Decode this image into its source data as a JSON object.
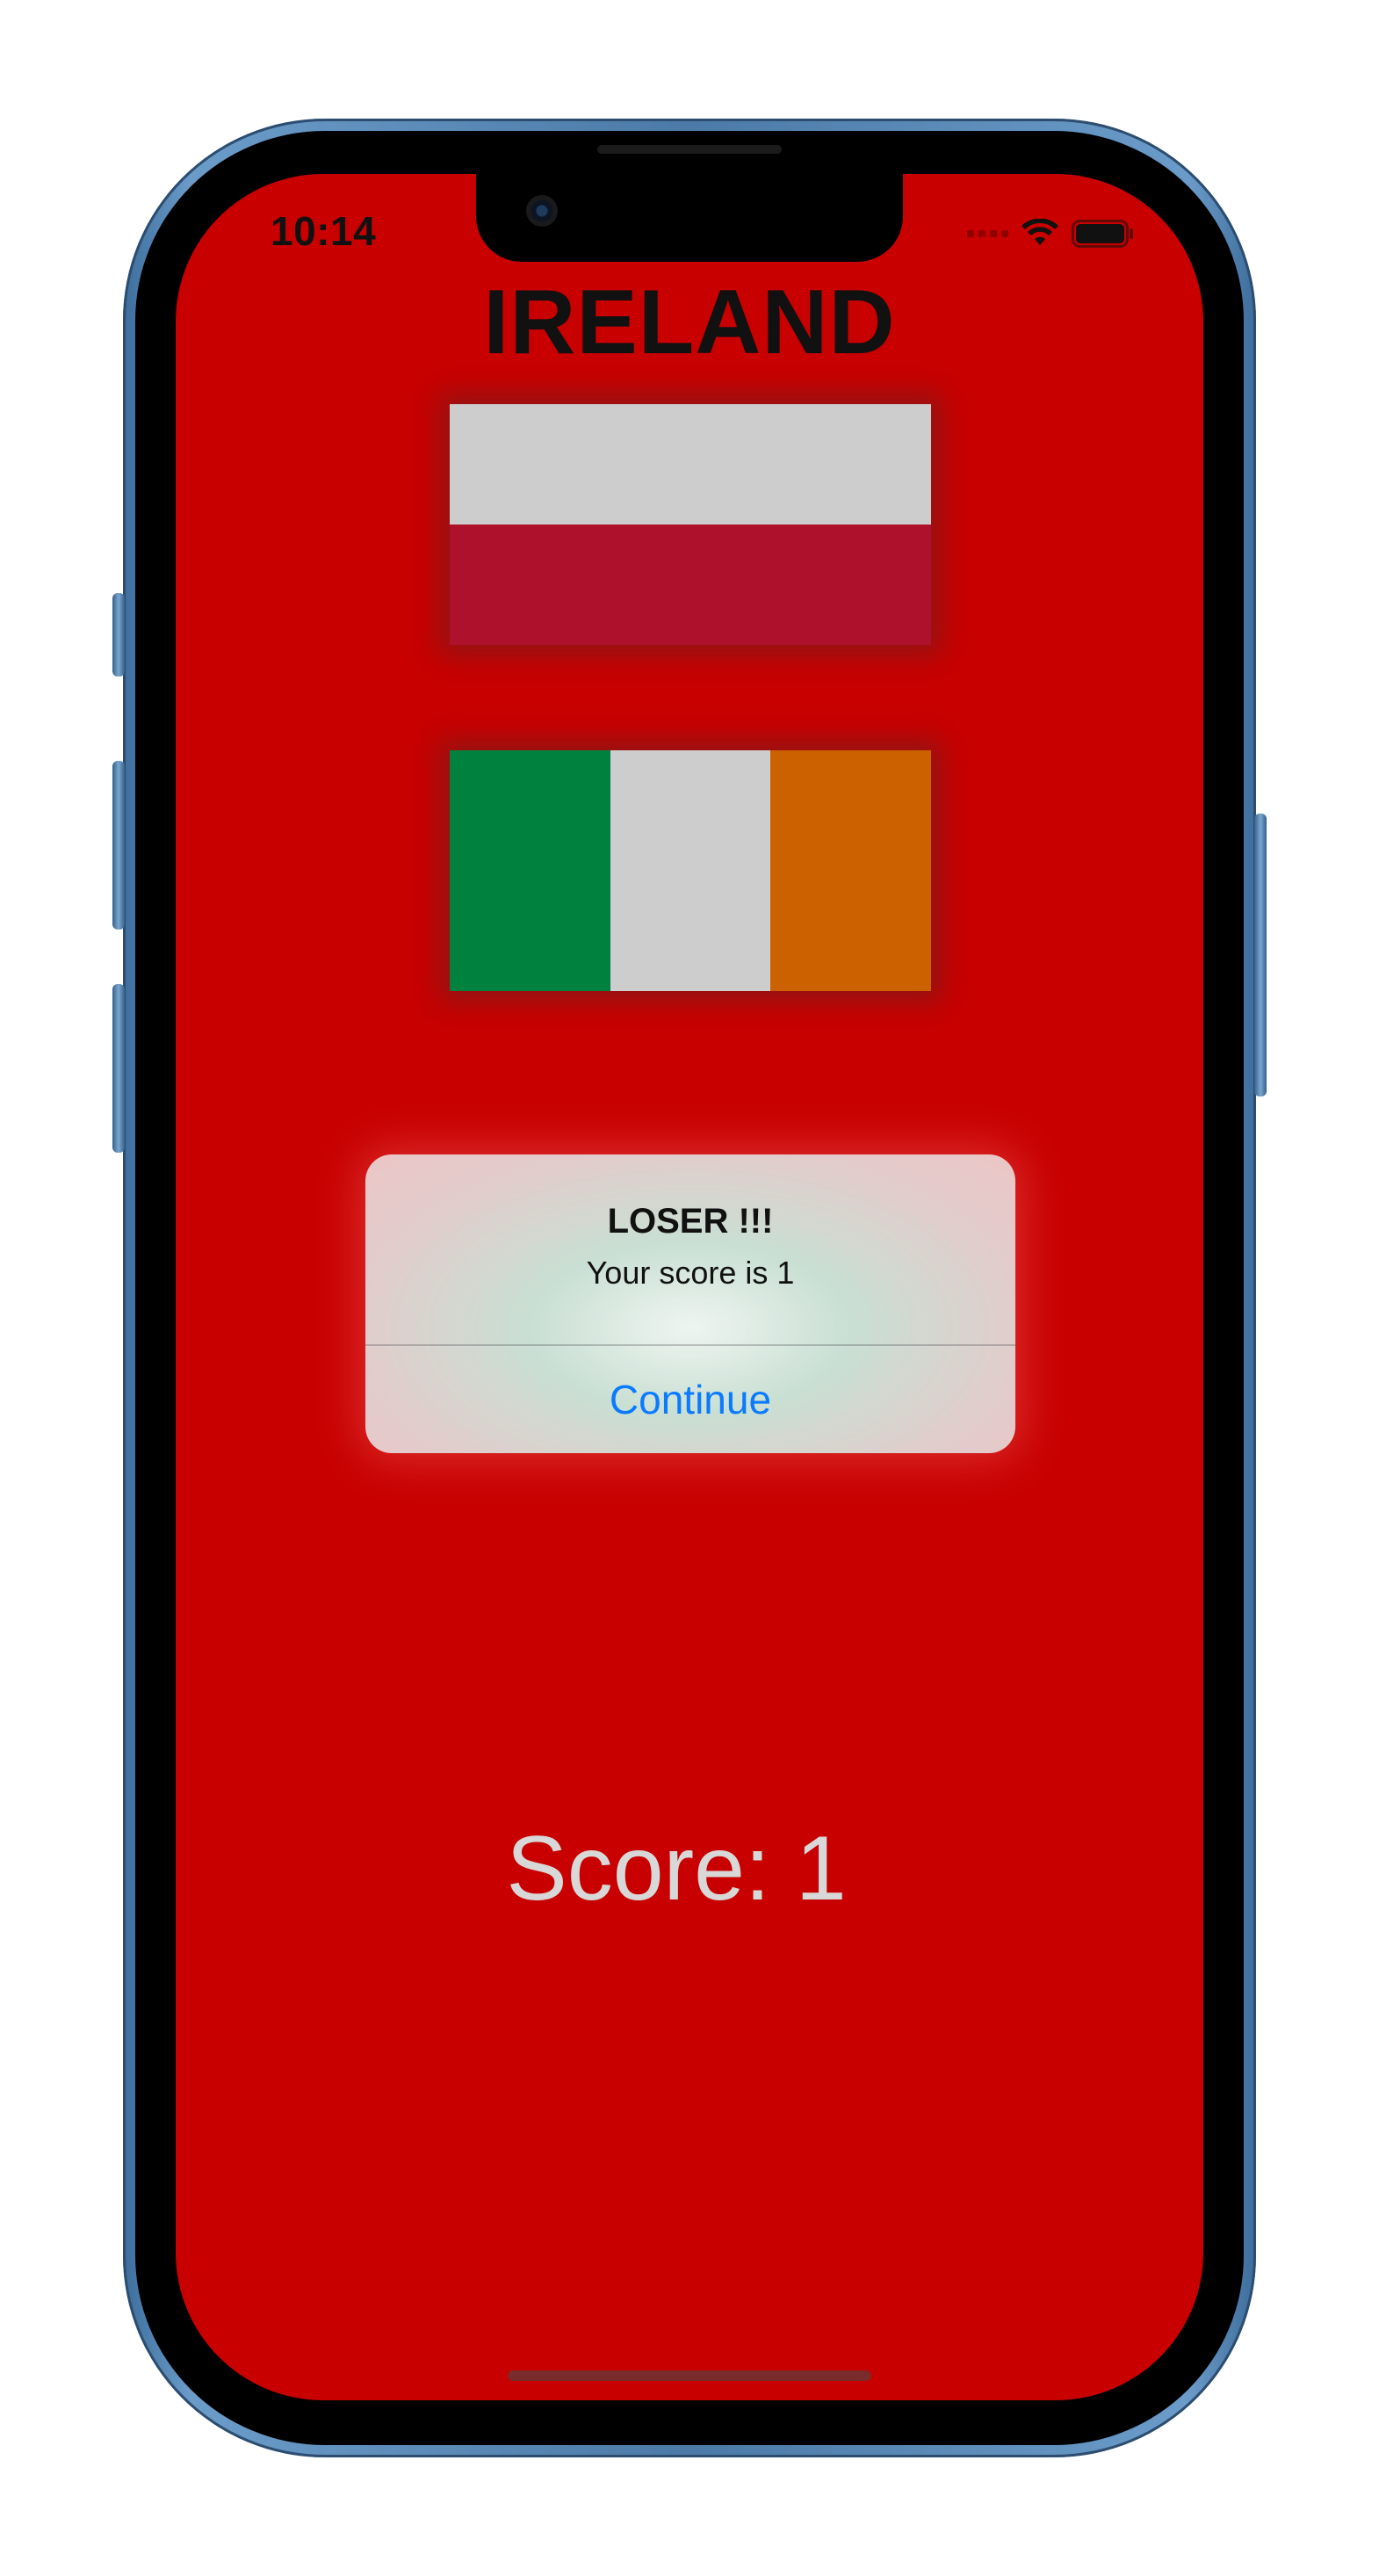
{
  "status_bar": {
    "time": "10:14",
    "wifi_icon": "wifi-icon",
    "battery_icon": "battery-icon"
  },
  "game": {
    "title": "IRELAND",
    "score_label": "Score: 1"
  },
  "flags": [
    {
      "name": "poland-flag",
      "stripes": [
        "#cdcdcd",
        "#ad112b"
      ],
      "orientation": "horizontal"
    },
    {
      "name": "ireland-flag",
      "stripes": [
        "#00823e",
        "#cdcdcd",
        "#cc6100"
      ],
      "orientation": "vertical"
    }
  ],
  "alert": {
    "title": "LOSER !!!",
    "message": "Your score is 1",
    "button_label": "Continue"
  },
  "colors": {
    "background": "#c80000",
    "alert_button": "#0a7aff",
    "score_text": "#d8d8d8"
  }
}
